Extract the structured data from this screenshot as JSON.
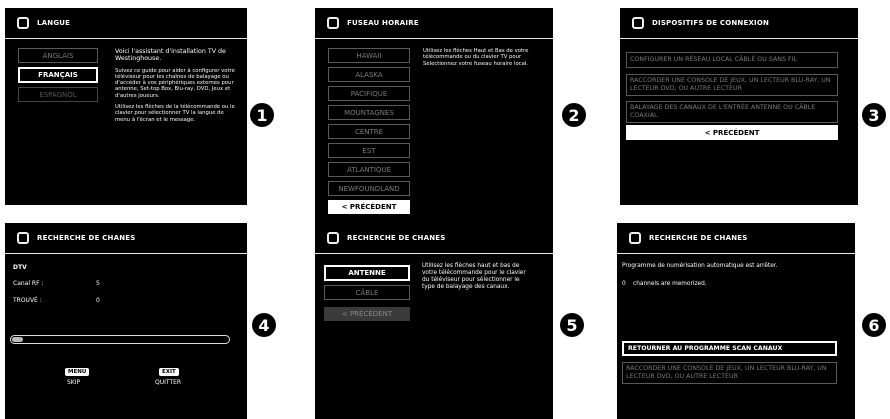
{
  "s1": {
    "title": "LANGUE",
    "options": [
      "ANGLAIS",
      "FRANÇAIS",
      "ESPAGNOL"
    ],
    "desc": [
      "Voici l'assistant d'installation TV de Westinghouse.",
      "Suivez ce guide pour aider à configurer votre téléviseur pour les chaînes de balayage ou d'accéder à vos périphériques externes pour antenne, Set-top Box, Blu-ray, DVD, Jeux et d'autres joueurs.",
      "Utilisez les flèches de la télécommande ou le clavier pour sélectionner TV la langue de menu à l'écran et le message."
    ],
    "badge": "1"
  },
  "s2": {
    "title": "FUSEAU HORAIRE",
    "options": [
      "HAWAII",
      "ALASKA",
      "PACIFIQUE",
      "MOUNTAGNES",
      "CENTRE",
      "EST",
      "ATLANTIQUE",
      "NEWFOUNDLAND"
    ],
    "back": "< PRÉCÉDENT",
    "desc": "Utilisez les flèches Haut et Bas de votre télécommande ou du clavier TV pour Sélectionnez votre fuseau horaire local.",
    "badge": "2"
  },
  "s3": {
    "title": "DISPOSITIFS DE CONNEXION",
    "options": [
      "CONFIGURER UN RÉSEAU LOCAL CÂBLÉ OU SANS FIL",
      "RACCORDER UNE CONSOLE DE JEUX, UN LECTEUR BLU-RAY, UN LECTEUR DVD, OU AUTRE LECTEUR",
      "BALAYAGE DES CANAUX DE L'ENTRÉE ANTENNE OU CÂBLE COAXIAL"
    ],
    "back": "< PRÉCÉDENT",
    "badge": "3"
  },
  "s4": {
    "title": "RECHERCHE DE CHANES",
    "dtv": "DTV",
    "canal_label": "Canal RF :",
    "canal_value": "5",
    "trouve_label": "TROUVÉ :",
    "trouve_value": "0",
    "progress": 0.05,
    "menu_key": "MENU",
    "menu_action": "SKIP",
    "exit_key": "EXIT",
    "exit_action": "QUITTER",
    "badge": "4"
  },
  "s5": {
    "title": "RECHERCHE DE CHANES",
    "options": [
      "ANTENNE",
      "CÂBLE"
    ],
    "back": "< PRÉCÉDENT",
    "desc": "Utilisez les flèches haut et bas de votre télécommande pour le clavier du téléviseur pour sélectionner le type de balayage des canaux.",
    "badge": "5"
  },
  "s6": {
    "title": "RECHERCHE DE CHANES",
    "line1": "Programme de numérisation automatique est arrêter.",
    "line2": "0    channels are memorized.",
    "options": [
      "RETOURNER AU PROGRAMME SCAN CANAUX",
      "RACCORDER UNE CONSOLE DE JEUX, UN LECTEUR BLU-RAY, UN LECTEUR DVD, OU AUTRE LECTEUR"
    ],
    "badge": "6"
  }
}
